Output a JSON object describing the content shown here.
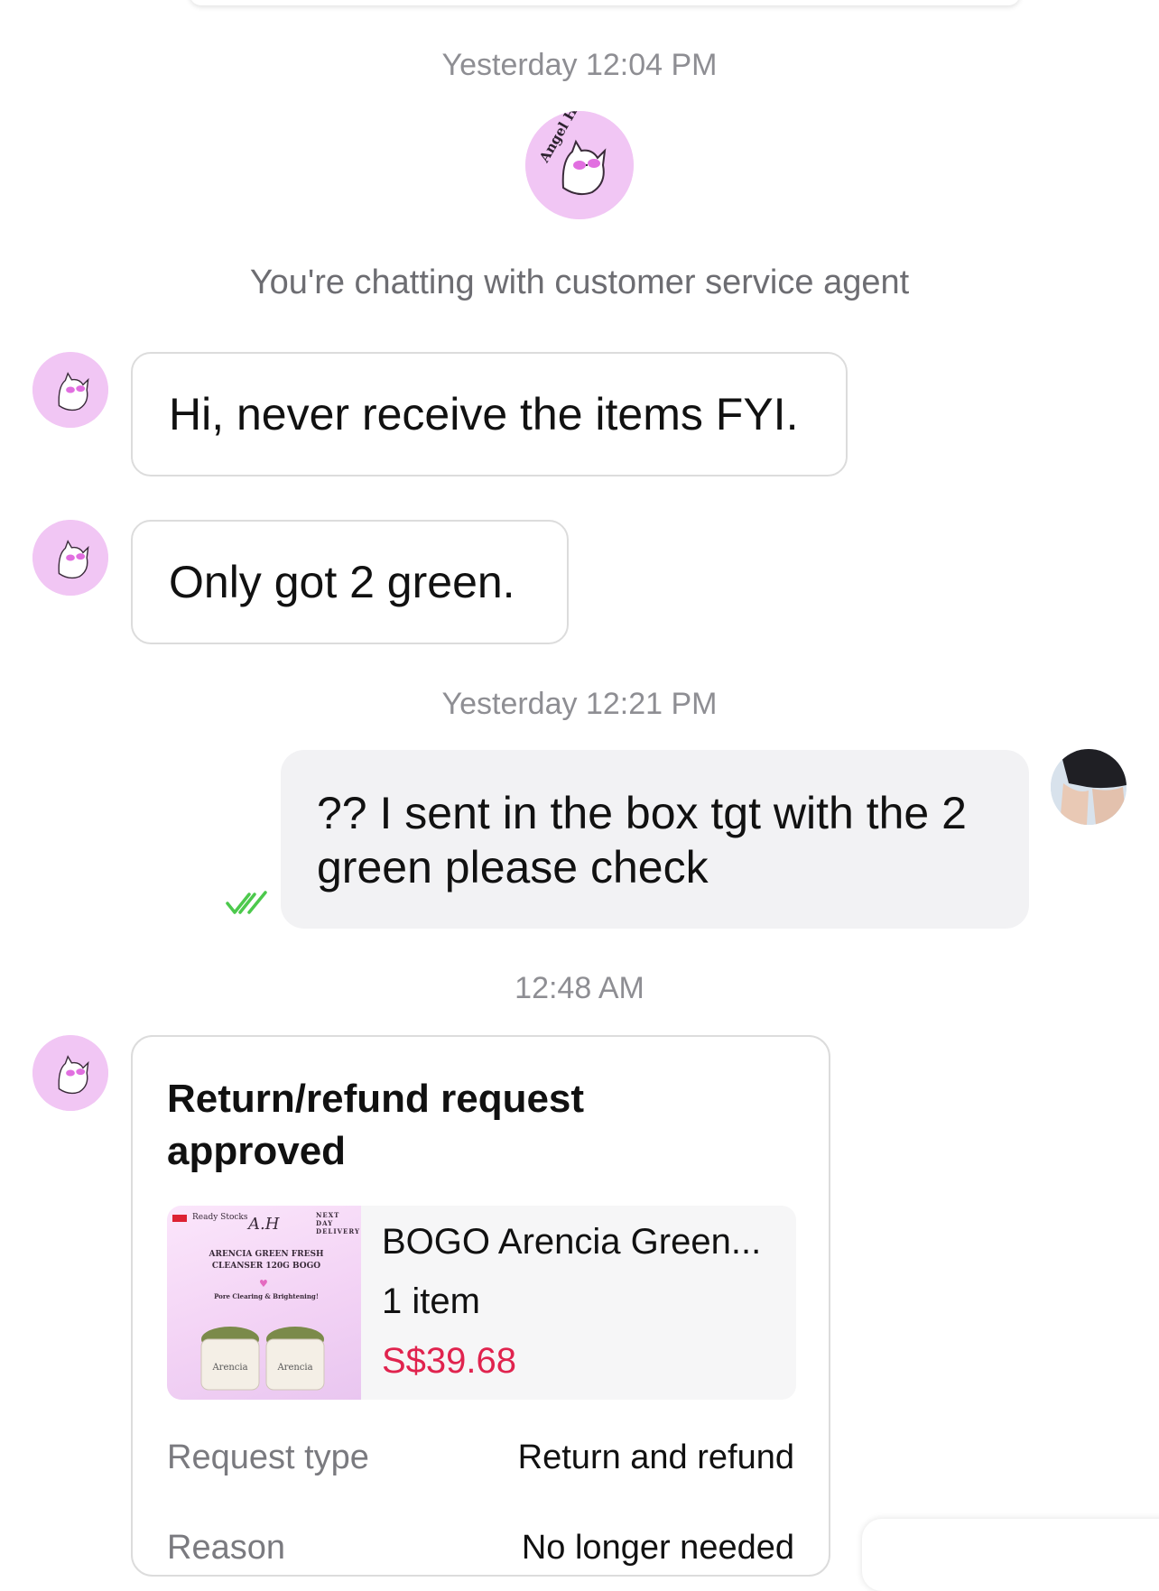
{
  "timestamps": [
    "Yesterday 12:04 PM",
    "Yesterday 12:21 PM",
    "12:48 AM"
  ],
  "shop": {
    "avatar_text": "Angel Havens",
    "system_note": "You're chatting with customer service agent"
  },
  "messages": [
    {
      "from": "shop",
      "text": "Hi, never receive the items FYI."
    },
    {
      "from": "shop",
      "text": "Only got 2 green."
    },
    {
      "from": "user",
      "text": "?? I sent in the box tgt with the 2 green please check",
      "status_icon": "double-check-icon"
    }
  ],
  "refund_card": {
    "title": "Return/refund request approved",
    "product": {
      "name": "BOGO Arencia Green...",
      "quantity": "1 item",
      "price": "S$39.68",
      "thumbnail": {
        "badge": "Ready Stocks",
        "brand": "A.H",
        "delivery": "NEXT DAY DELIVERY",
        "headline": "ARENCIA GREEN FRESH CLEANSER 120G BOGO",
        "tagline": "Pore Clearing & Brightening!",
        "jar_label": "Arencia"
      }
    },
    "rows": [
      {
        "label": "Request type",
        "value": "Return and refund"
      },
      {
        "label": "Reason",
        "value": "No longer needed"
      }
    ]
  },
  "colors": {
    "price": "#e0234e",
    "check": "#4cc94c",
    "avatar_bg": "#f1c6f4"
  }
}
